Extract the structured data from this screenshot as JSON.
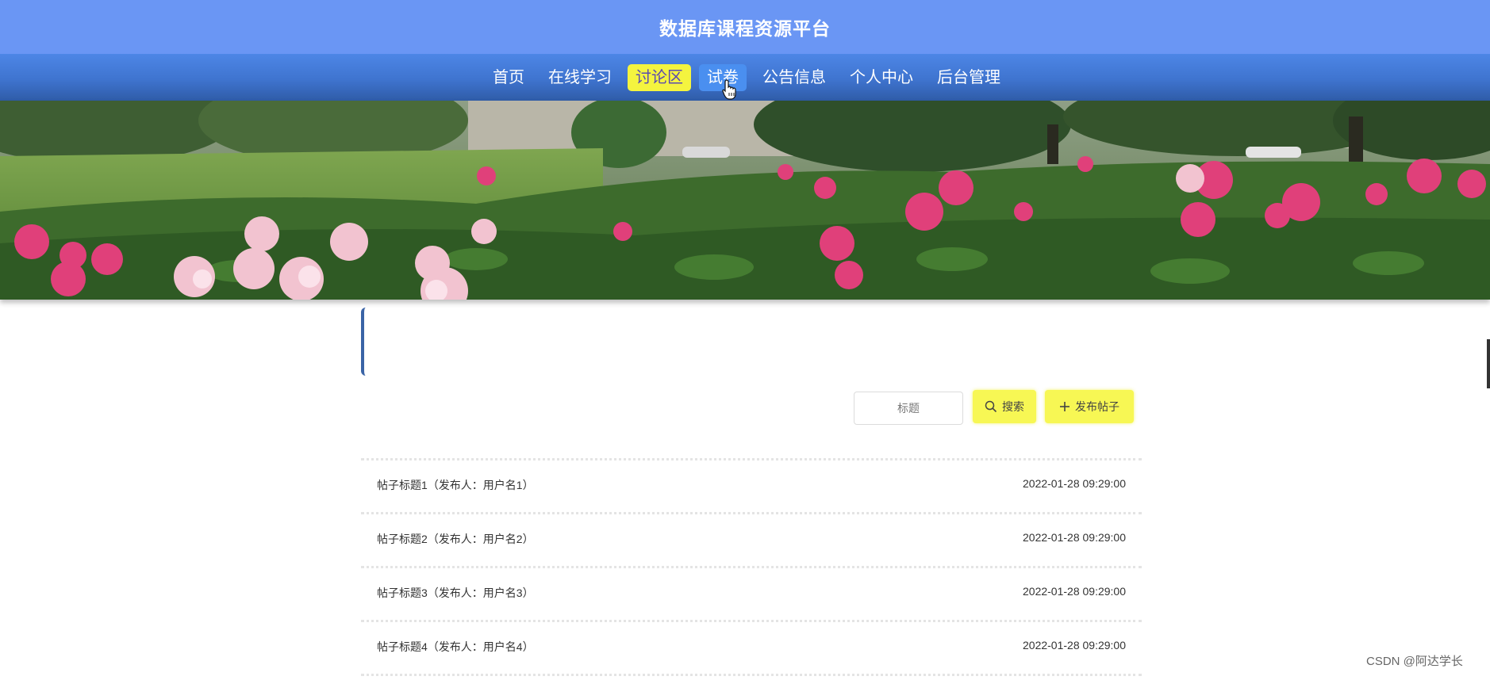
{
  "header": {
    "title": "数据库课程资源平台"
  },
  "nav": {
    "items": [
      {
        "label": "首页"
      },
      {
        "label": "在线学习"
      },
      {
        "label": "讨论区"
      },
      {
        "label": "试卷"
      },
      {
        "label": "公告信息"
      },
      {
        "label": "个人中心"
      },
      {
        "label": "后台管理"
      }
    ],
    "active_index": 2,
    "hover_index": 3
  },
  "toolbar": {
    "search_placeholder": "标题",
    "search_label": "搜索",
    "post_label": "发布帖子"
  },
  "posts": [
    {
      "title": "帖子标题1（发布人：用户名1）",
      "time": "2022-01-28 09:29:00"
    },
    {
      "title": "帖子标题2（发布人：用户名2）",
      "time": "2022-01-28 09:29:00"
    },
    {
      "title": "帖子标题3（发布人：用户名3）",
      "time": "2022-01-28 09:29:00"
    },
    {
      "title": "帖子标题4（发布人：用户名4）",
      "time": "2022-01-28 09:29:00"
    }
  ],
  "watermark": "CSDN @阿达学长",
  "colors": {
    "header_bg": "#6a96f4",
    "nav_bg": "#3f74cf",
    "highlight": "#f4f43f",
    "button_bg": "#f7f754"
  }
}
